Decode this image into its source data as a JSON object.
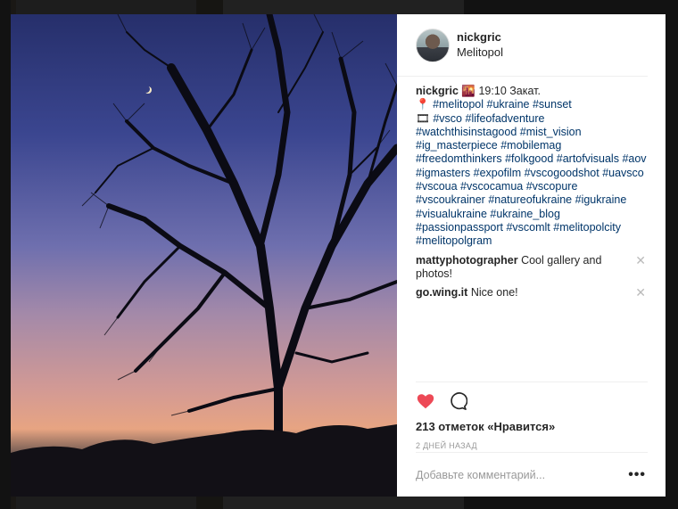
{
  "post": {
    "username": "nickgric",
    "location": "Melitopol",
    "caption_user": "nickgric",
    "caption_emoji": "🌇",
    "caption_text": "19:10 Закат.",
    "pin_emoji": "📍",
    "line1_tags": [
      "#melitopol",
      "#ukraine",
      "#sunset"
    ],
    "badge_emoji": "🎞",
    "tags": [
      "#vsco",
      "#lifeofadventure",
      "#watchthisinstagood",
      "#mist_vision",
      "#ig_masterpiece",
      "#mobilemag",
      "#freedomthinkers",
      "#folkgood",
      "#artofvisuals",
      "#aov",
      "#igmasters",
      "#expofilm",
      "#vscogoodshot",
      "#uavsco",
      "#vscoua",
      "#vscocamua",
      "#vscopure",
      "#vscoukrainer",
      "#natureofukraine",
      "#igukraine",
      "#visualukraine",
      "#ukraine_blog",
      "#passionpassport",
      "#vscomlt",
      "#melitopolcity",
      "#melitopolgram"
    ]
  },
  "comments": [
    {
      "user": "mattyphotographer",
      "text": "Cool gallery and photos!"
    },
    {
      "user": "go.wing.it",
      "text": "Nice one!"
    }
  ],
  "actions": {
    "likes": "213 отметок «Нравится»",
    "date": "2 ДНЕЙ НАЗАД",
    "comment_placeholder": "Добавьте комментарий...",
    "more": "•••"
  },
  "colors": {
    "like": "#ed4956",
    "hashtag": "#003569"
  },
  "icons": {
    "like": "heart-icon",
    "comment": "comment-bubble-icon",
    "remove": "close-icon",
    "more": "more-options-icon"
  }
}
